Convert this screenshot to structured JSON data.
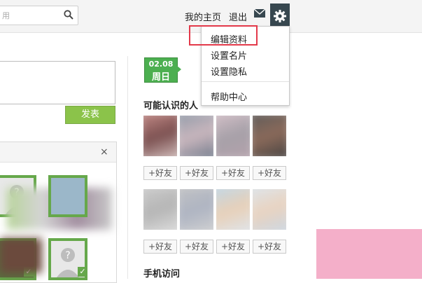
{
  "search": {
    "value": "用"
  },
  "nav": {
    "home": "我的主页",
    "logout": "退出"
  },
  "menu": {
    "items": [
      "编辑资料",
      "设置名片",
      "设置隐私"
    ],
    "help": "帮助中心"
  },
  "post_button": "发表",
  "close_glyph": "×",
  "date": {
    "day": "02.08",
    "weekday": "周日"
  },
  "people_section": {
    "title": "可能认识的人"
  },
  "add_friend": "+好友",
  "mobile_section": {
    "title": "手机访问"
  },
  "colors": {
    "accent_green": "#8bc34a",
    "highlight_red": "#e3394a",
    "gear_bg": "#37474f"
  }
}
